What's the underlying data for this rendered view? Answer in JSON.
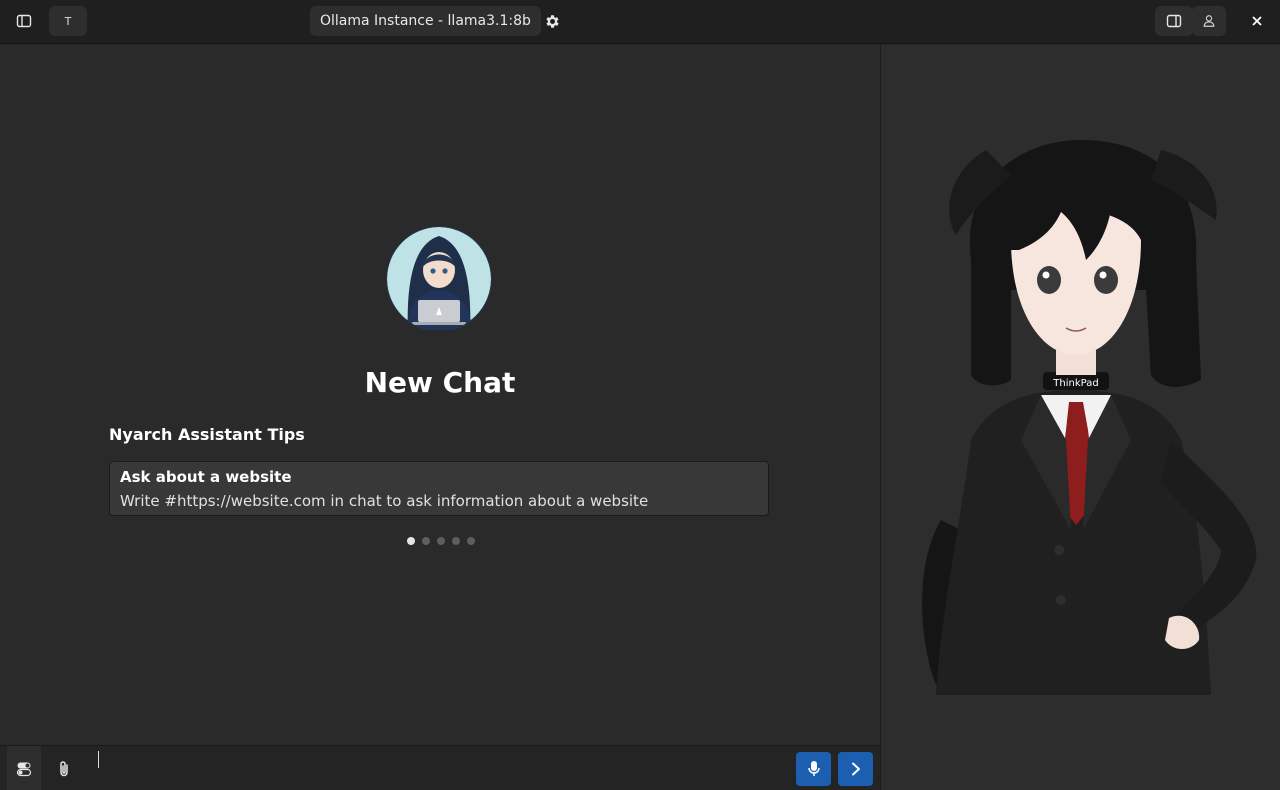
{
  "header": {
    "title": "Ollama Instance - llama3.1:8b",
    "profile_letter": "T",
    "sidebar_toggle_icon": "sidebar-show-icon",
    "settings_icon": "gear-icon",
    "panel_icon": "panel-right-icon",
    "avatar_icon": "person-icon",
    "close_icon": "close-icon"
  },
  "main": {
    "heading": "New Chat",
    "tips_title": "Nyarch Assistant Tips",
    "tip": {
      "title": "Ask about a website",
      "body": "Write #https://website.com in chat to ask information about a website"
    },
    "tip_pages": 5,
    "active_tip": 0
  },
  "input": {
    "value": "",
    "placeholder": "",
    "left_icons": [
      "toggle-icon",
      "paperclip-icon"
    ],
    "right_icons": [
      "microphone-icon",
      "send-arrow-icon"
    ]
  },
  "colors": {
    "accent": "#1c5fb0",
    "header_bg": "#1f1f1f",
    "chat_bg": "#2a2a2a",
    "side_bg": "#2d2d2d",
    "card_bg": "#383838"
  }
}
